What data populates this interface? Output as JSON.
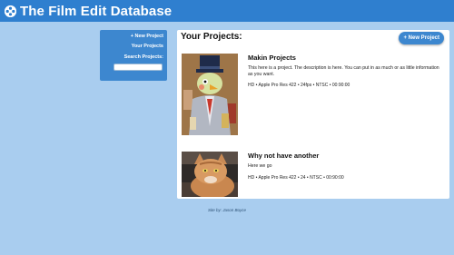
{
  "app": {
    "title": "The Film Edit Database"
  },
  "sidebar": {
    "new_project": "+ New Project",
    "your_projects": "Your Projects",
    "search_label": "Search Projects:",
    "search_value": ""
  },
  "main": {
    "title": "Your Projects:",
    "new_button": "+ New Project"
  },
  "projects": [
    {
      "title": "Makin Projects",
      "description": "This here is a project. The description is here. You can put in as much or as little information as you want.",
      "meta": "HD • Apple Pro Res 422 • 24fps • NTSC • 00:90:00",
      "thumbnail": "bird-with-top-hat"
    },
    {
      "title": "Why not have another",
      "description": "Here we go",
      "meta": "HD • Apple Pro Res 422 • 24 • NTSC • 00:90:00",
      "thumbnail": "orange-cat"
    }
  ],
  "footer": {
    "credit": "Site by: Jason Boyce"
  },
  "colors": {
    "topbar": "#2f7fcf",
    "background": "#a9cdef",
    "accent": "#3d87cf"
  }
}
